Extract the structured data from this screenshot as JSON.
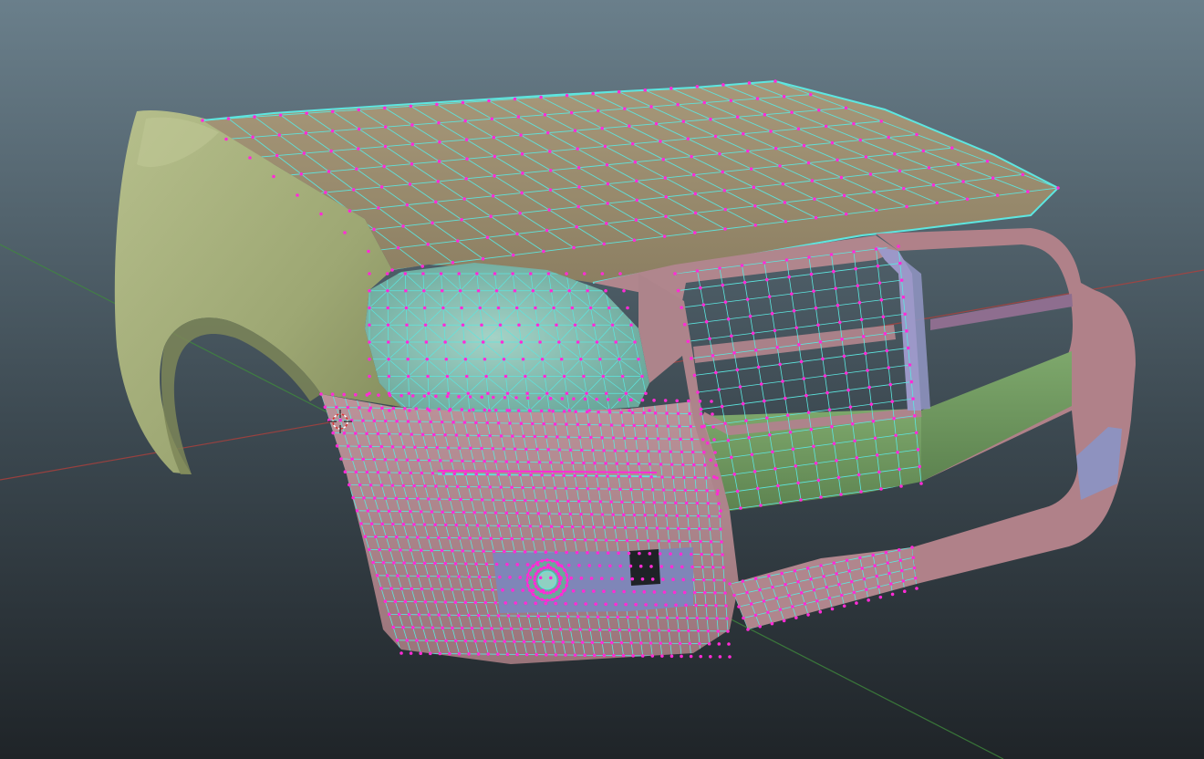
{
  "viewport": {
    "background_top": "#6a7f8b",
    "background_bottom": "#1f2428",
    "axis_x_color": "#b0403c",
    "axis_y_color": "#3f8a3c"
  },
  "materials": {
    "fender": "#a3ad7a",
    "hood": "#9b8d6a",
    "bumper": "#b0868d",
    "headlight": "#7fb6a8",
    "grille_insert": "#6f9a5e",
    "fog_housing": "#8e92bf",
    "grille_bar": "#8e6e8f"
  },
  "overlay": {
    "edge_color": "#5de6e0",
    "vertex_color": "#ff2bd6"
  },
  "icons": {
    "cursor": "3d-cursor-icon"
  }
}
